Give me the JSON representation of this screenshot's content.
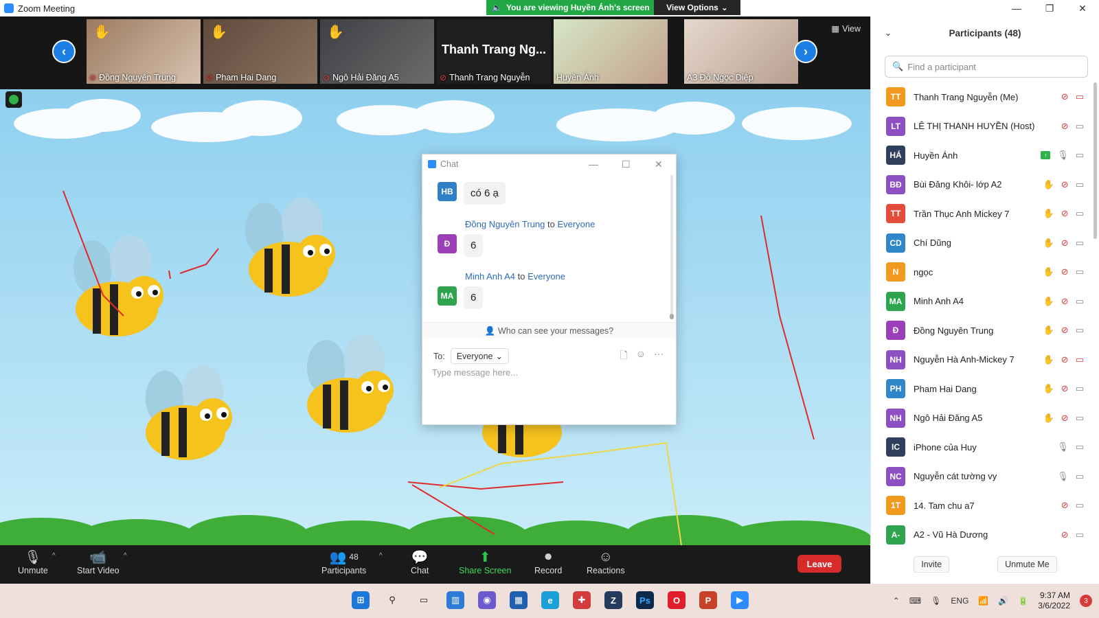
{
  "window": {
    "title": "Zoom Meeting",
    "minimize": "—",
    "restore": "❐",
    "close": "✕"
  },
  "share_banner": {
    "text": "You are viewing Huyền Ánh's screen",
    "view_options": "View Options"
  },
  "video_strip": {
    "view_label": "View",
    "tiles": [
      {
        "name": "Đồng Nguyên Trung",
        "hand": true,
        "muted": true,
        "color": "#8a6a52"
      },
      {
        "name": "Pham Hai Dang",
        "hand": true,
        "muted": true,
        "color": "#5f4a3c"
      },
      {
        "name": "Ngô Hải Đăng A5",
        "hand": true,
        "muted": true,
        "color": "#4a4a50"
      },
      {
        "name": "Thanh Trang Nguyễn",
        "big_name": "Thanh Trang Ng...",
        "hand": false,
        "muted": true
      },
      {
        "name": "Huyền Ánh",
        "hand": false,
        "muted": false,
        "color": "#b9a79a"
      },
      {
        "name": "A3 Đỗ Ngọc Diệp",
        "hand": false,
        "muted": false,
        "color": "#c8b6aa"
      }
    ]
  },
  "chat": {
    "title": "Chat",
    "messages": [
      {
        "initials": "HB",
        "color": "#2e7fc5",
        "text": "có 6 ạ"
      },
      {
        "initials": "Đ",
        "color": "#9b3fb8",
        "sender": "Đồng Nguyên Trung",
        "to_word": "to",
        "recipient": "Everyone",
        "text": "6"
      },
      {
        "initials": "MA",
        "color": "#2ea44f",
        "sender": "Minh Anh A4",
        "to_word": "to",
        "recipient": "Everyone",
        "text": "6"
      }
    ],
    "who_can_see": "Who can see your messages?",
    "to_label": "To:",
    "to_value": "Everyone",
    "placeholder": "Type message here..."
  },
  "toolbar": {
    "unmute": "Unmute",
    "start_video": "Start Video",
    "participants": "Participants",
    "participants_count": "48",
    "chat": "Chat",
    "share_screen": "Share Screen",
    "record": "Record",
    "reactions": "Reactions",
    "leave": "Leave"
  },
  "participants": {
    "title": "Participants (48)",
    "search_placeholder": "Find a participant",
    "invite": "Invite",
    "unmute_me": "Unmute Me",
    "list": [
      {
        "initials": "TT",
        "color": "#f29a1f",
        "name": "Thanh Trang Nguyễn (Me)",
        "hand": "",
        "mic": "off",
        "cam": "off"
      },
      {
        "initials": "LT",
        "color": "#8e4fc2",
        "name": "LÊ THỊ THANH HUYỀN (Host)",
        "hand": "",
        "mic": "off",
        "cam": "on"
      },
      {
        "initials": "HÁ",
        "color": "#2f3f5c",
        "name": "Huyền Ánh",
        "hand": "",
        "mic": "on",
        "cam": "on",
        "share": true
      },
      {
        "initials": "BĐ",
        "color": "#8e4fc2",
        "name": "Bùi Đăng Khôi- lớp A2",
        "hand": "full",
        "mic": "off",
        "cam": "on"
      },
      {
        "initials": "TT",
        "color": "#e34b3a",
        "name": "Trần Thục Anh Mickey 7",
        "hand": "faint",
        "mic": "off",
        "cam": "on"
      },
      {
        "initials": "CD",
        "color": "#2f86c9",
        "name": "Chí Dũng",
        "hand": "full",
        "mic": "off",
        "cam": "on"
      },
      {
        "initials": "N",
        "color": "#f29a1f",
        "name": "ngọc",
        "hand": "faint",
        "mic": "off",
        "cam": "on"
      },
      {
        "initials": "MA",
        "color": "#2ea44f",
        "name": "Minh Anh A4",
        "hand": "full",
        "mic": "off",
        "cam": "on"
      },
      {
        "initials": "Đ",
        "color": "#9b3fb8",
        "name": "Đồng Nguyên Trung",
        "hand": "full",
        "mic": "off",
        "cam": "on"
      },
      {
        "initials": "NH",
        "color": "#8e4fc2",
        "name": "Nguyễn Hà Anh-Mickey 7",
        "hand": "full",
        "mic": "off",
        "cam": "off"
      },
      {
        "initials": "PH",
        "color": "#2f86c9",
        "name": "Pham Hai Dang",
        "hand": "faint",
        "mic": "off",
        "cam": "on"
      },
      {
        "initials": "NH",
        "color": "#8e4fc2",
        "name": "Ngô Hải Đăng A5",
        "hand": "full",
        "mic": "off",
        "cam": "on"
      },
      {
        "initials": "IC",
        "color": "#2f3f5c",
        "name": "iPhone của Huy",
        "hand": "",
        "mic": "on",
        "cam": "on"
      },
      {
        "initials": "NC",
        "color": "#8e4fc2",
        "name": "Nguyễn cát tường vy",
        "hand": "",
        "mic": "on",
        "cam": "on"
      },
      {
        "initials": "1T",
        "color": "#f29a1f",
        "name": "14. Tam chu a7",
        "hand": "",
        "mic": "off",
        "cam": "on"
      },
      {
        "initials": "A-",
        "color": "#2ea44f",
        "name": "A2 - Vũ Hà Dương",
        "hand": "",
        "mic": "off",
        "cam": "on"
      }
    ]
  },
  "taskbar": {
    "language": "ENG",
    "time": "9:37 AM",
    "date": "3/6/2022",
    "notifications": "3"
  }
}
